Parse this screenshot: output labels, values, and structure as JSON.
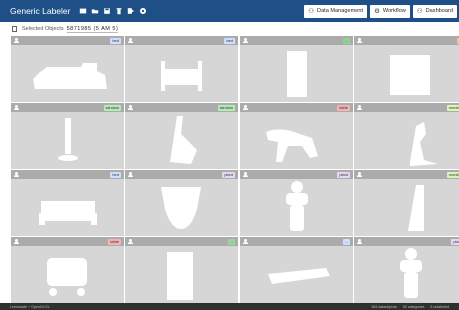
{
  "app": {
    "title": "Generic Labeler"
  },
  "nav": [
    {
      "label": "Data Management",
      "icon": "users-icon"
    },
    {
      "label": "Workflow",
      "icon": "gears-icon"
    },
    {
      "label": "Dashboard",
      "icon": "users-icon"
    }
  ],
  "subbar": {
    "label": "Selected Objects",
    "count": "5871985 (5 AM 5)"
  },
  "tiles": [
    {
      "badge": "bed",
      "badge_color": "#cfe0ff",
      "shape": "train"
    },
    {
      "badge": "bed",
      "badge_color": "#cfe0ff",
      "shape": "bed"
    },
    {
      "badge": "...",
      "badge_color": "#8fd38f",
      "shape": "door"
    },
    {
      "badge": "...",
      "badge_color": "#f5c490",
      "shape": "square"
    },
    {
      "badge": "window",
      "badge_color": "#b5ebb5",
      "shape": "lamp"
    },
    {
      "badge": "window",
      "badge_color": "#b5ebb5",
      "shape": "blade"
    },
    {
      "badge": "table",
      "badge_color": "#f7b3b3",
      "shape": "chair"
    },
    {
      "badge": "monitor",
      "badge_color": "#d9f5b9",
      "shape": "boot"
    },
    {
      "badge": "bed",
      "badge_color": "#cfe0ff",
      "shape": "sofa"
    },
    {
      "badge": "plant",
      "badge_color": "#e6d7f5",
      "shape": "bucket"
    },
    {
      "badge": "plant",
      "badge_color": "#e6d7f5",
      "shape": "figure"
    },
    {
      "badge": "monitor",
      "badge_color": "#d9f5b9",
      "shape": "frame"
    },
    {
      "badge": "table",
      "badge_color": "#f7b3b3",
      "shape": "cart"
    },
    {
      "badge": "...",
      "badge_color": "#9bd59b",
      "shape": "panel"
    },
    {
      "badge": "...",
      "badge_color": "#cfe0ff",
      "shape": "plank"
    },
    {
      "badge": "plant",
      "badge_color": "#e6d7f5",
      "shape": "figure"
    }
  ],
  "status": {
    "left": "Lemonade + OpenGL/CL",
    "right": [
      "653 dataobjects",
      "52 categories",
      "5 unlabeled"
    ]
  }
}
